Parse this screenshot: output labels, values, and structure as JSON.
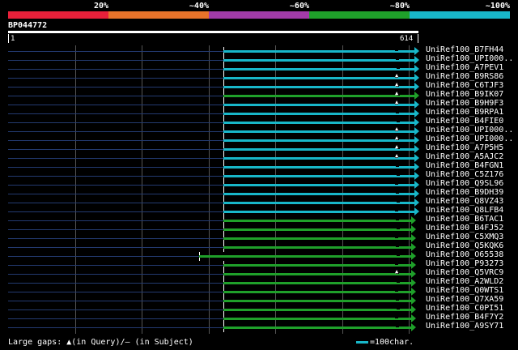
{
  "scale": {
    "labels": [
      "20%",
      "~40%",
      "~60%",
      "~80%",
      "~100%"
    ],
    "colors": [
      "#e8203a",
      "#e8732a",
      "#a23ba8",
      "#1fa02a",
      "#18b7c9"
    ]
  },
  "query": {
    "id": "BP044772",
    "start": "1",
    "end": "614"
  },
  "colors": {
    "cyan": "#18b7c9",
    "green": "#1fa02a",
    "stub": "#233a70"
  },
  "hits": [
    {
      "label": "UniRef100_B7FH44",
      "color": "cyan",
      "qgap": false
    },
    {
      "label": "UniRef100_UPI000..",
      "color": "cyan",
      "qgap": false
    },
    {
      "label": "UniRef100_A7PEV1",
      "color": "cyan",
      "qgap": false
    },
    {
      "label": "UniRef100_B9RS86",
      "color": "cyan",
      "qgap": true
    },
    {
      "label": "UniRef100_C6TJF3",
      "color": "cyan",
      "qgap": true
    },
    {
      "label": "UniRef100_B9IK07",
      "color": "green",
      "qgap": true
    },
    {
      "label": "UniRef100_B9H9F3",
      "color": "cyan",
      "qgap": true
    },
    {
      "label": "UniRef100_B9RPA1",
      "color": "cyan",
      "qgap": false
    },
    {
      "label": "UniRef100_B4FIE0",
      "color": "cyan",
      "qgap": false
    },
    {
      "label": "UniRef100_UPI000..",
      "color": "cyan",
      "qgap": true
    },
    {
      "label": "UniRef100_UPI000..",
      "color": "cyan",
      "qgap": true
    },
    {
      "label": "UniRef100_A7P5H5",
      "color": "cyan",
      "qgap": true
    },
    {
      "label": "UniRef100_A5AJC2",
      "color": "cyan",
      "qgap": true
    },
    {
      "label": "UniRef100_B4FGN1",
      "color": "cyan",
      "qgap": false
    },
    {
      "label": "UniRef100_C5Z176",
      "color": "cyan",
      "qgap": false
    },
    {
      "label": "UniRef100_Q9SL96",
      "color": "cyan",
      "qgap": false
    },
    {
      "label": "UniRef100_B9DH39",
      "color": "cyan",
      "qgap": false
    },
    {
      "label": "UniRef100_Q8VZ43",
      "color": "cyan",
      "qgap": false
    },
    {
      "label": "UniRef100_Q8LFB4",
      "color": "cyan",
      "qgap": false
    },
    {
      "label": "UniRef100_B6TAC1",
      "color": "green",
      "qgap": false
    },
    {
      "label": "UniRef100_B4FJ52",
      "color": "green",
      "qgap": false
    },
    {
      "label": "UniRef100_C5XMQ3",
      "color": "green",
      "qgap": false
    },
    {
      "label": "UniRef100_Q5KQK6",
      "color": "green",
      "qgap": false
    },
    {
      "label": "UniRef100_O65538",
      "color": "green",
      "qgap": false,
      "long": true
    },
    {
      "label": "UniRef100_P93273",
      "color": "green",
      "qgap": false
    },
    {
      "label": "UniRef100_Q5VRC9",
      "color": "green",
      "qgap": true
    },
    {
      "label": "UniRef100_A2WLD2",
      "color": "green",
      "qgap": false
    },
    {
      "label": "UniRef100_Q0WTS1",
      "color": "green",
      "qgap": false
    },
    {
      "label": "UniRef100_Q7XA59",
      "color": "green",
      "qgap": false
    },
    {
      "label": "UniRef100_C0PI51",
      "color": "green",
      "qgap": false
    },
    {
      "label": "UniRef100_B4F7Y2",
      "color": "green",
      "qgap": false
    },
    {
      "label": "UniRef100_A9SY71",
      "color": "green",
      "qgap": false
    }
  ],
  "footer": {
    "gaps_text": "Large gaps: ▲(in Query)/– (in Subject)",
    "legend_text": "=100char."
  }
}
